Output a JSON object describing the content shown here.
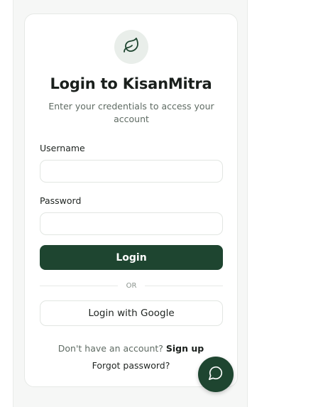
{
  "login": {
    "logo_icon": "leaf-icon",
    "title": "Login to KisanMitra",
    "subtitle": "Enter your credentials to access your account",
    "username_label": "Username",
    "username_value": "",
    "password_label": "Password",
    "password_value": "",
    "login_button": "Login",
    "divider_text": "OR",
    "google_button": "Login with Google",
    "signup_prompt": "Don't have an account?",
    "signup_link": "Sign up",
    "forgot_password": "Forgot password?"
  },
  "chat": {
    "icon": "chat-bubble-icon"
  },
  "colors": {
    "primary": "#1e4530",
    "logo_bg": "#e9eeea",
    "muted_text": "#5f6b63"
  }
}
